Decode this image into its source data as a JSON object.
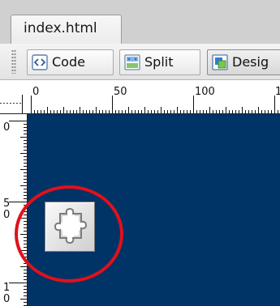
{
  "document_tab": {
    "label": "index.html",
    "icon": "document-tab"
  },
  "toolbar": {
    "code_label": "Code",
    "split_label": "Split",
    "design_label": "Desig",
    "selected": "design"
  },
  "ruler": {
    "horizontal_labels": [
      "0",
      "50",
      "100",
      "1"
    ],
    "vertical_labels": [
      "0",
      "5",
      "0",
      "1",
      "0"
    ],
    "units": "px"
  },
  "canvas": {
    "background_color": "#003366"
  },
  "plugin_placeholder": {
    "icon": "puzzle-piece-icon"
  },
  "annotation": {
    "color": "#e0111b",
    "shape": "circle"
  }
}
